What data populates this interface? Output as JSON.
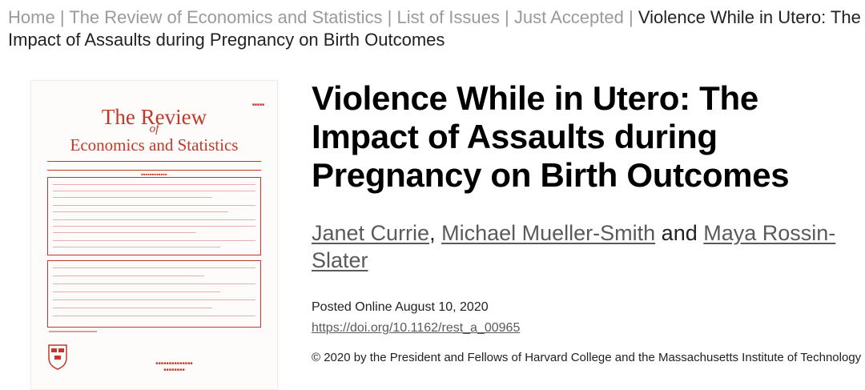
{
  "breadcrumb": {
    "items": [
      "Home",
      "The Review of Economics and Statistics",
      "List of Issues",
      "Just Accepted"
    ],
    "separator": "|",
    "current": "Violence While in Utero: The Impact of Assaults during Pregnancy on Birth Outcomes"
  },
  "cover": {
    "title_line1": "The Review",
    "title_line2": "of",
    "title_line3": "Economics and Statistics",
    "brand_color": "#c0392b",
    "icon": "harvard-shield-icon"
  },
  "article": {
    "title": "Violence While in Utero: The Impact of Assaults during Pregnancy on Birth Outcomes",
    "authors": [
      "Janet Currie",
      "Michael Mueller-Smith",
      "Maya Rossin-Slater"
    ],
    "author_sep_1": ", ",
    "author_sep_2": " and ",
    "posted_online": "Posted Online August 10, 2020",
    "doi": "https://doi.org/10.1162/rest_a_00965",
    "copyright": "© 2020 by the President and Fellows of Harvard College and the Massachusetts Institute of Technology"
  }
}
